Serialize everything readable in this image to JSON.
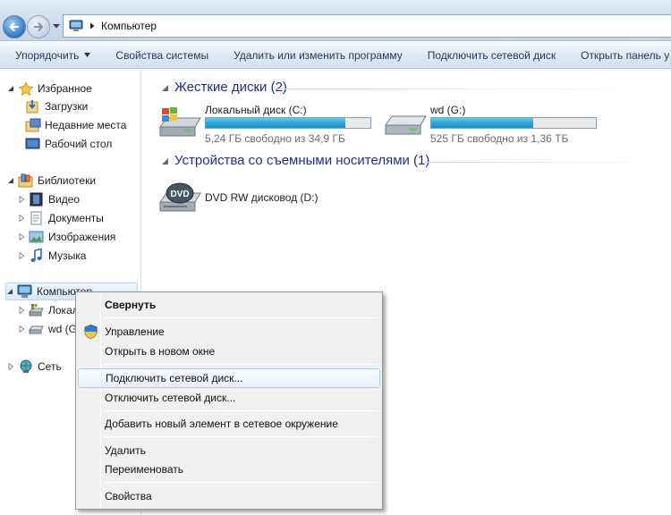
{
  "address": {
    "crumb": "Компьютер"
  },
  "commandbar": {
    "items": [
      "Упорядочить",
      "Свойства системы",
      "Удалить или изменить программу",
      "Подключить сетевой диск",
      "Открыть панель у"
    ]
  },
  "navpane": {
    "favorites": "Избранное",
    "downloads": "Загрузки",
    "recent": "Недавние места",
    "desktop": "Рабочий стол",
    "libraries": "Библиотеки",
    "video": "Видео",
    "documents": "Документы",
    "images": "Изображения",
    "music": "Музыка",
    "computer": "Компьютер",
    "local_disk": "Локал",
    "wd_disk": "wd (G",
    "network": "Сеть"
  },
  "content": {
    "hard_drives_header": "Жесткие диски (2)",
    "removable_header": "Устройства со съемными носителями (1)",
    "drives": [
      {
        "name": "Локальный диск (C:)",
        "free": "5,24 ГБ свободно из 34,9 ГБ",
        "used_fraction": 0.85
      },
      {
        "name": "wd (G:)",
        "free": "525 ГБ свободно из 1,36 ТБ",
        "used_fraction": 0.62
      }
    ],
    "dvd": {
      "name": "DVD RW дисковод (D:)",
      "icon_text": "DVD"
    }
  },
  "context_menu": {
    "collapse": "Свернуть",
    "manage": "Управление",
    "open_new_window": "Открыть в новом окне",
    "map_drive": "Подключить сетевой диск...",
    "disconnect_drive": "Отключить сетевой диск...",
    "add_network_location": "Добавить новый элемент в сетевое окружение",
    "delete": "Удалить",
    "rename": "Переименовать",
    "properties": "Свойства"
  },
  "colors": {
    "accent": "#1e3287",
    "bar_fill": "#27a4d6",
    "hover_border": "#a8cbf1"
  }
}
